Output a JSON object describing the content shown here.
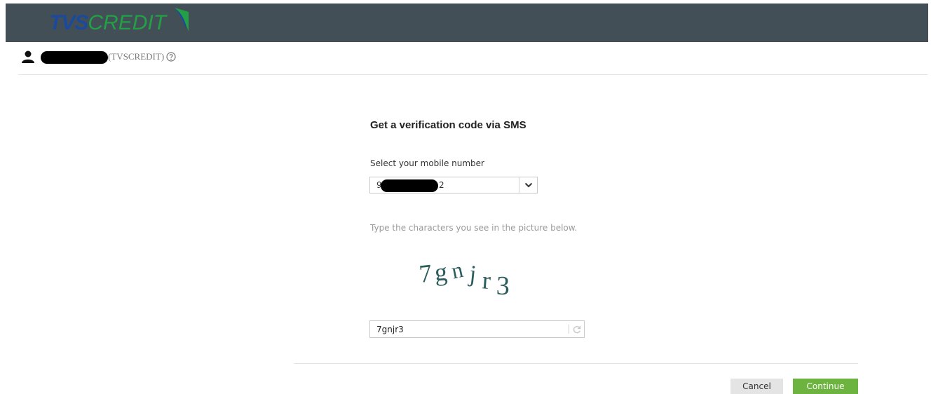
{
  "header": {
    "logo_part1": "TVS",
    "logo_part2": "CREDIT"
  },
  "user": {
    "org": "(TVSCREDIT)"
  },
  "form": {
    "title": "Get a verification code via SMS",
    "mobile_label": "Select your mobile number",
    "mobile_value_prefix": "97",
    "mobile_value_suffix": "2",
    "captcha_hint": "Type the characters you see in the picture below.",
    "captcha_image_text": "7gnjr3",
    "captcha_input_value": "7gnjr3"
  },
  "actions": {
    "cancel_label": "Cancel",
    "continue_label": "Continue"
  },
  "colors": {
    "topbar": "#424f57",
    "logo_blue": "#1b4a9c",
    "logo_green": "#23a046",
    "continue_green": "#6cb33f"
  },
  "icons": [
    "user-icon",
    "help-icon",
    "chevron-down-icon",
    "refresh-icon"
  ]
}
